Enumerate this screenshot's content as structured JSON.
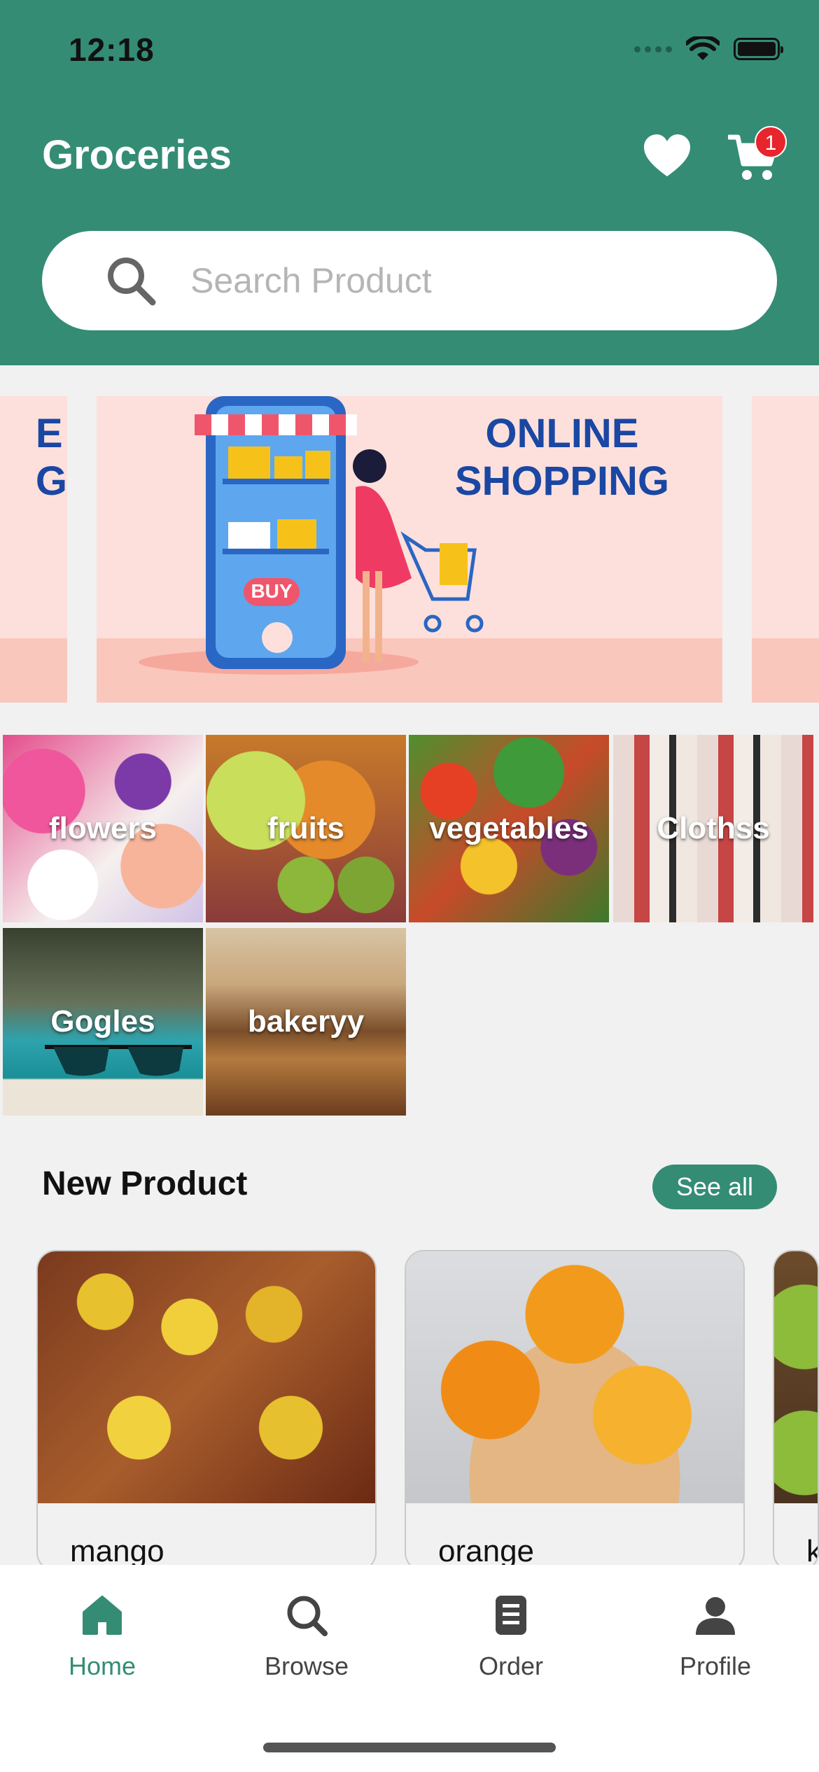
{
  "status_bar": {
    "time": "12:18"
  },
  "header": {
    "title": "Groceries",
    "cart_count": "1"
  },
  "search": {
    "placeholder": "Search Product"
  },
  "banner": {
    "title_line1": "ONLINE",
    "title_line2": "SHOPPING",
    "prev_line1": "E",
    "prev_line2": "G",
    "phone_button": "BUY"
  },
  "categories": [
    {
      "label": "flowers"
    },
    {
      "label": "fruits"
    },
    {
      "label": "vegetables"
    },
    {
      "label": "Clothss"
    },
    {
      "label": "Gogles"
    },
    {
      "label": "bakeryy"
    }
  ],
  "new_product": {
    "title": "New Product",
    "see_all_label": "See all",
    "items": [
      {
        "name": "mango"
      },
      {
        "name": "orange"
      },
      {
        "name": "k"
      }
    ]
  },
  "tabbar": {
    "items": [
      {
        "label": "Home",
        "active": true
      },
      {
        "label": "Browse",
        "active": false
      },
      {
        "label": "Order",
        "active": false
      },
      {
        "label": "Profile",
        "active": false
      }
    ]
  },
  "colors": {
    "primary": "#348c75",
    "badge": "#e8242c",
    "banner_text": "#1a47a3",
    "banner_bg": "#fde0dc"
  },
  "icons": {
    "status": [
      "cellular-signal-icon",
      "wifi-icon",
      "battery-icon"
    ],
    "header": [
      "heart-icon",
      "cart-icon"
    ],
    "search": "search-icon",
    "tabs": [
      "home-icon",
      "search-icon",
      "document-icon",
      "person-icon"
    ]
  }
}
